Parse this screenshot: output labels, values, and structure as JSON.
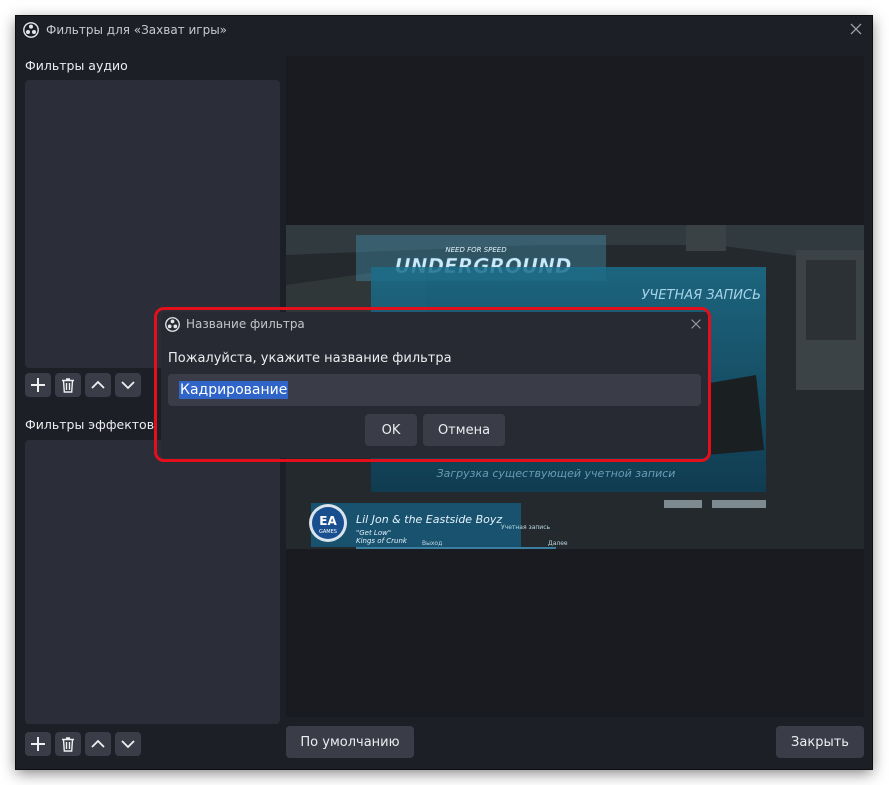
{
  "window": {
    "title": "Фильтры для «Захват игры»"
  },
  "audio_filters": {
    "label": "Фильтры аудио"
  },
  "effect_filters": {
    "label": "Фильтры эффектов"
  },
  "game": {
    "logo_text": "UNDERGROUND",
    "logo_top": "NEED FOR SPEED",
    "menu_title": "УЧЕТНАЯ ЗАПИСЬ",
    "song_artist": "Lil Jon & the Eastside Boyz",
    "song_title": "\"Get Low\"",
    "song_album": "Kings of Crunk",
    "ea_label": "EA",
    "ea_games": "GAMES",
    "footer_left": "Выход",
    "footer_right": "Далее",
    "footer_mid": "Учетная запись",
    "menu_status": "Загрузка существующей учетной записи"
  },
  "buttons": {
    "defaults": "По умолчанию",
    "close": "Закрыть"
  },
  "dialog": {
    "title": "Название фильтра",
    "prompt": "Пожалуйста, укажите название фильтра",
    "input_value": "Кадрирование",
    "ok": "OK",
    "cancel": "Отмена"
  },
  "colors": {
    "highlight_outline": "#e3101b",
    "selection": "#2f64c9",
    "window_bg": "#1d1f26",
    "panel_bg": "#2b2e38",
    "button_bg": "#3a3d48"
  }
}
